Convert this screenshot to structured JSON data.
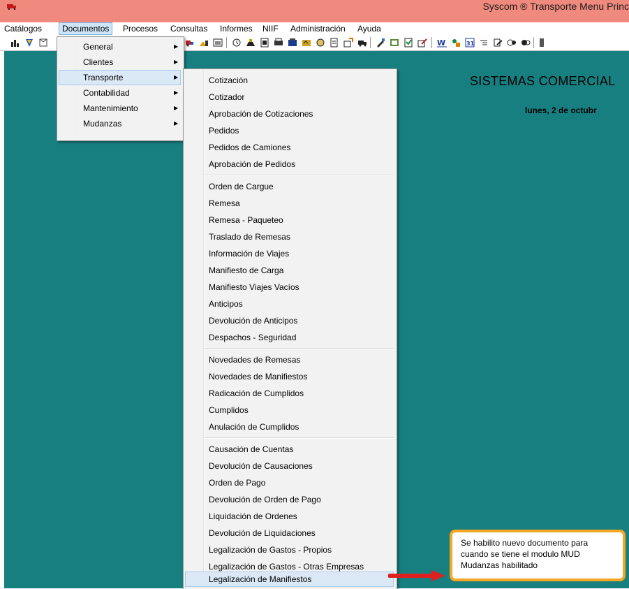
{
  "window": {
    "title": "Syscom ® Transporte Menu Princ"
  },
  "menubar": [
    "Catálogos",
    "Documentos",
    "Procesos",
    "Consultas",
    "Informes",
    "NIIF",
    "Administración",
    "Ayuda"
  ],
  "workspace": {
    "company_title": "SISTEMAS COMERCIAL",
    "date": "lunes, 2 de octubr"
  },
  "documentos_menu": [
    "General",
    "Clientes",
    "Transporte",
    "Contabilidad",
    "Mantenimiento",
    "Mudanzas"
  ],
  "transporte_menu": {
    "group1": [
      "Cotización",
      "Cotizador",
      "Aprobación de Cotizaciones",
      "Pedidos",
      "Pedidos de Camiones",
      "Aprobación de Pedidos"
    ],
    "group2": [
      "Orden de Cargue",
      "Remesa",
      "Remesa - Paqueteo",
      "Traslado de Remesas",
      "Información de Viajes",
      "Manifiesto de Carga",
      "Manifiesto Viajes Vacíos",
      "Anticipos",
      "Devolución de Anticipos",
      "Despachos - Seguridad"
    ],
    "group3": [
      "Novedades de Remesas",
      "Novedades de Manifiestos",
      "Radicación de Cumplidos",
      "Cumplidos",
      "Anulación de Cumplidos"
    ],
    "group4": [
      "Causación de Cuentas",
      "Devolución de Causaciones",
      "Orden de Pago",
      "Devolución de Orden de Pago",
      "Liquidación de Ordenes",
      "Devolución de Liquidaciones",
      "Legalización de Gastos - Propios",
      "Legalización de Gastos - Otras Empresas",
      "Legalización de Manifiestos"
    ]
  },
  "callout": {
    "line1": "Se habilito nuevo documento para",
    "line2": "cuando se tiene el modulo MUD",
    "line3": "Mudanzas habilitado"
  },
  "colors": {
    "titlebar": "#f08a7e",
    "workspace": "#177f80",
    "callout_border": "#f5a623",
    "arrow": "#e02020",
    "highlight": "#dbe8f6"
  },
  "icons": [
    "app-truck-icon",
    "chart-icon",
    "shield-icon",
    "box-icon",
    "truck-icon",
    "monitor-icon",
    "calendar-icon",
    "people-icon",
    "document-icon",
    "printer-icon",
    "save-icon",
    "folder-icon",
    "report-icon",
    "copy-icon",
    "notes-icon",
    "word-icon",
    "excel-icon",
    "user-icon",
    "calendar-31-icon",
    "grid-icon",
    "edit-icon",
    "help-icon"
  ]
}
